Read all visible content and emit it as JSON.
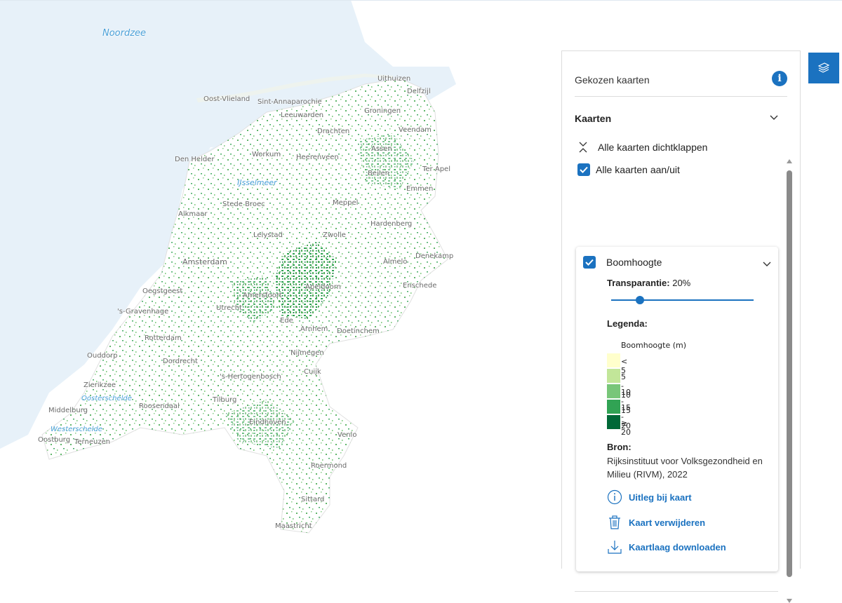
{
  "map": {
    "labels": {
      "sea": "Noordzee",
      "ijsselmeer": "IJsselmeer",
      "oosterschelde": "Oosterschelde",
      "westerschelde": "Westerschelde",
      "uithuizen": "Uithuizen",
      "delfzijl": "Delfzijl",
      "oost_vlieland": "Oost-Vlieland",
      "sint_annaparochie": "Sint-Annaparochie",
      "leeuwarden": "Leeuwarden",
      "groningen": "Groningen",
      "drachten": "Drachten",
      "veendam": "Veendam",
      "assen": "Assen",
      "workum": "Workum",
      "heerenveen": "Heerenveen",
      "den_helder": "Den Helder",
      "beilen": "Beilen",
      "ter_apel": "Ter Apel",
      "emmen": "Emmen",
      "stede_broec": "Stede Broec",
      "meppel": "Meppel",
      "alkmaar": "Alkmaar",
      "hardenberg": "Hardenberg",
      "lelystad": "Lelystad",
      "zwolle": "Zwolle",
      "amsterdam": "Amsterdam",
      "almelo": "Almelo",
      "denekamp": "Denekamp",
      "oegstgeest": "Oegstgeest",
      "amersfoort": "Amersfoort",
      "apeldoorn": "Apeldoorn",
      "enschede": "Enschede",
      "den_haag": "'s-Gravenhage",
      "utrecht": "Utrecht",
      "ede": "Ede",
      "arnhem": "Arnhem",
      "doetinchem": "Doetinchem",
      "rotterdam": "Rotterdam",
      "ouddorp": "Ouddorp",
      "nijmegen": "Nijmegen",
      "dordrecht": "Dordrecht",
      "cuijk": "Cuijk",
      "den_bosch": "'s-Hertogenbosch",
      "zierikzee": "Zierikzee",
      "tilburg": "Tilburg",
      "middelburg": "Middelburg",
      "roosendaal": "Roosendaal",
      "eindhoven": "Eindhoven",
      "venlo": "Venlo",
      "oostburg": "Oostburg",
      "terneuzen": "Terneuzen",
      "roermond": "Roermond",
      "sittard": "Sittard",
      "maastricht": "Maastricht"
    }
  },
  "panel": {
    "title": "Gekozen kaarten",
    "section_title": "Kaarten",
    "collapse_all": "Alle kaarten dichtklappen",
    "toggle_all": "Alle kaarten aan/uit",
    "layer": {
      "name": "Boomhoogte",
      "transparency_label": "Transparantie:",
      "transparency_value": "20%",
      "transparency_fraction": 0.2,
      "legend_title": "Legenda:",
      "legend_subtitle": "Boomhoogte (m)",
      "legend_items": [
        {
          "label": "< 5",
          "color": "#ffffcc"
        },
        {
          "label": "5 - 10",
          "color": "#c2e699"
        },
        {
          "label": "10 - 15",
          "color": "#78c679"
        },
        {
          "label": "15 - 20",
          "color": "#31a354"
        },
        {
          "label": "≥ 20",
          "color": "#006837"
        }
      ],
      "source_title": "Bron:",
      "source_text": "Rijksinstituut voor Volksgezondheid en Milieu (RIVM), 2022",
      "actions": {
        "explain": "Uitleg bij kaart",
        "remove": "Kaart verwijderen",
        "download": "Kaartlaag downloaden"
      }
    }
  },
  "colors": {
    "accent": "#1b72c0",
    "sea": "#e7f1f9",
    "forest": "#31a354"
  }
}
